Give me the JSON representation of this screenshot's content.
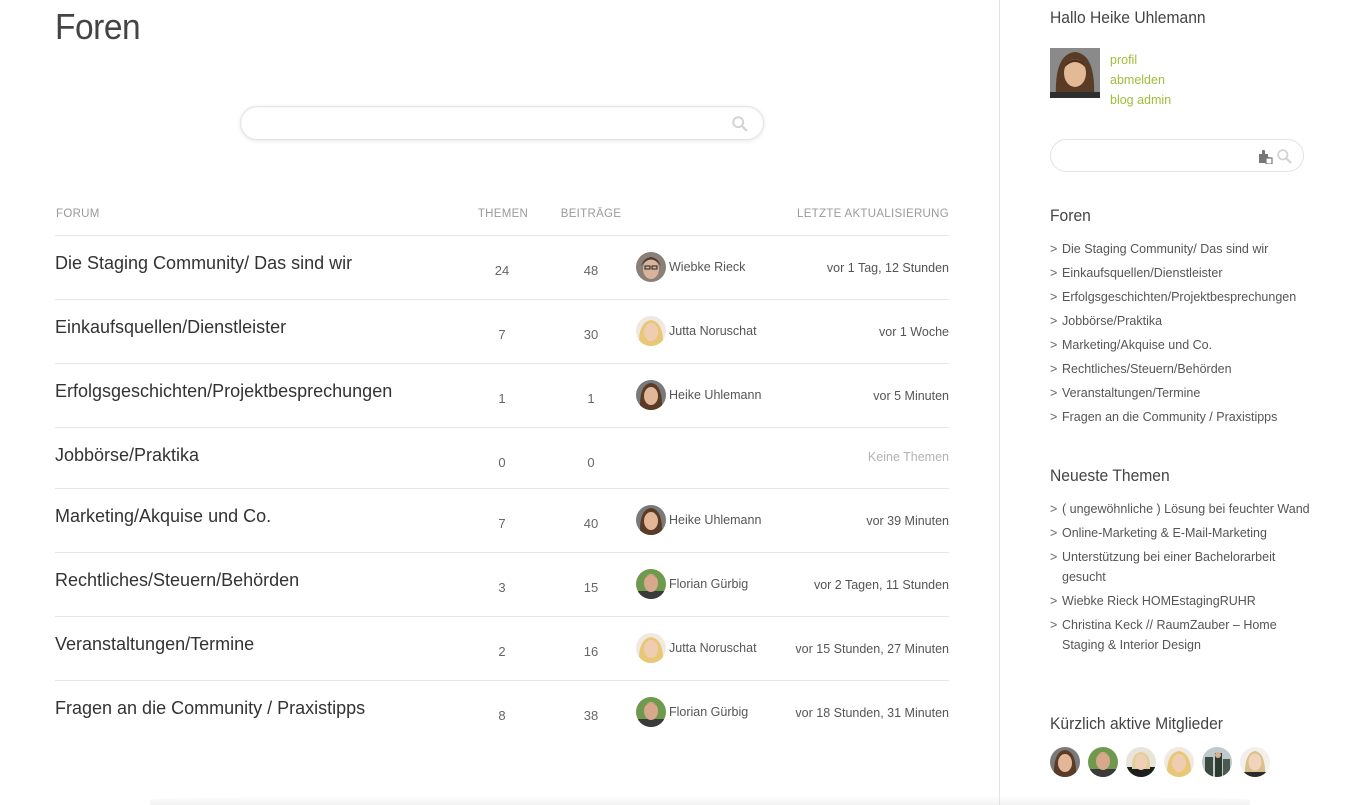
{
  "page_title": "Foren",
  "search": {
    "placeholder": "",
    "value": ""
  },
  "table": {
    "headers": {
      "forum": "FORUM",
      "themen": "THEMEN",
      "beitraege": "BEITRÄGE",
      "update": "LETZTE AKTUALISIERUNG"
    },
    "rows": [
      {
        "name": "Die Staging Community/ Das sind wir",
        "themen": "24",
        "beitraege": "48",
        "user": "Wiebke Rieck",
        "time": "vor 1 Tag, 12 Stunden"
      },
      {
        "name": "Einkaufsquellen/Dienstleister",
        "themen": "7",
        "beitraege": "30",
        "user": "Jutta Noruschat",
        "time": "vor 1 Woche"
      },
      {
        "name": "Erfolgsgeschichten/Projektbesprechungen",
        "themen": "1",
        "beitraege": "1",
        "user": "Heike Uhlemann",
        "time": "vor 5 Minuten"
      },
      {
        "name": "Jobbörse/Praktika",
        "themen": "0",
        "beitraege": "0",
        "user": "",
        "time": "Keine Themen"
      },
      {
        "name": "Marketing/Akquise und Co.",
        "themen": "7",
        "beitraege": "40",
        "user": "Heike Uhlemann",
        "time": "vor 39 Minuten"
      },
      {
        "name": "Rechtliches/Steuern/Behörden",
        "themen": "3",
        "beitraege": "15",
        "user": "Florian Gürbig",
        "time": "vor 2 Tagen, 11 Stunden"
      },
      {
        "name": "Veranstaltungen/Termine",
        "themen": "2",
        "beitraege": "16",
        "user": "Jutta Noruschat",
        "time": "vor 15 Stunden, 27 Minuten"
      },
      {
        "name": "Fragen an die Community / Praxistipps",
        "themen": "8",
        "beitraege": "38",
        "user": "Florian Gürbig",
        "time": "vor 18 Stunden, 31 Minuten"
      }
    ]
  },
  "sidebar": {
    "greeting": "Hallo Heike Uhlemann",
    "links": {
      "profile": "profil",
      "logout": "abmelden",
      "admin": "blog admin"
    },
    "search": {
      "placeholder": "",
      "value": ""
    },
    "forums_heading": "Foren",
    "arrow": ">",
    "forums": [
      "Die Staging Community/ Das sind wir",
      "Einkaufsquellen/Dienstleister",
      "Erfolgsgeschichten/Projektbesprechungen",
      "Jobbörse/Praktika",
      "Marketing/Akquise und Co.",
      "Rechtliches/Steuern/Behörden",
      "Veranstaltungen/Termine",
      "Fragen an die Community / Praxistipps"
    ],
    "topics_heading": "Neueste Themen",
    "topics": [
      "( ungewöhnliche ) Lösung bei feuchter Wand",
      "Online-Marketing & E-Mail-Marketing",
      "Unterstützung bei einer Bachelorarbeit gesucht",
      "Wiebke Rieck HOMEstagingRUHR",
      "Christina Keck // RaumZauber – Home Staging & Interior Design"
    ],
    "members_heading": "Kürzlich aktive Mitglieder"
  },
  "colors": {
    "link_green": "#9fbe3a",
    "text": "#333333",
    "muted": "#9a9a9a",
    "divider": "#e6e6e6"
  }
}
